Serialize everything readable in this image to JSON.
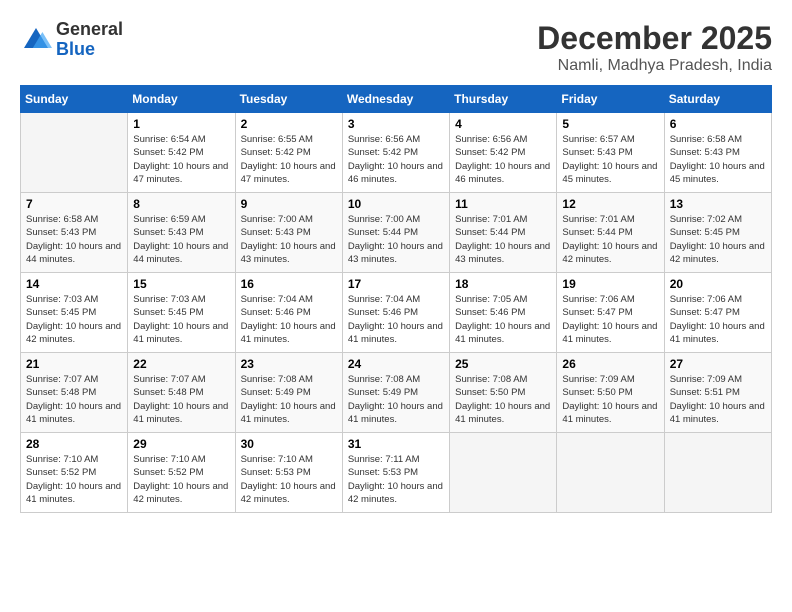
{
  "logo": {
    "general": "General",
    "blue": "Blue"
  },
  "title": "December 2025",
  "subtitle": "Namli, Madhya Pradesh, India",
  "headers": [
    "Sunday",
    "Monday",
    "Tuesday",
    "Wednesday",
    "Thursday",
    "Friday",
    "Saturday"
  ],
  "weeks": [
    [
      {
        "num": "",
        "sunrise": "",
        "sunset": "",
        "daylight": ""
      },
      {
        "num": "1",
        "sunrise": "Sunrise: 6:54 AM",
        "sunset": "Sunset: 5:42 PM",
        "daylight": "Daylight: 10 hours and 47 minutes."
      },
      {
        "num": "2",
        "sunrise": "Sunrise: 6:55 AM",
        "sunset": "Sunset: 5:42 PM",
        "daylight": "Daylight: 10 hours and 47 minutes."
      },
      {
        "num": "3",
        "sunrise": "Sunrise: 6:56 AM",
        "sunset": "Sunset: 5:42 PM",
        "daylight": "Daylight: 10 hours and 46 minutes."
      },
      {
        "num": "4",
        "sunrise": "Sunrise: 6:56 AM",
        "sunset": "Sunset: 5:42 PM",
        "daylight": "Daylight: 10 hours and 46 minutes."
      },
      {
        "num": "5",
        "sunrise": "Sunrise: 6:57 AM",
        "sunset": "Sunset: 5:43 PM",
        "daylight": "Daylight: 10 hours and 45 minutes."
      },
      {
        "num": "6",
        "sunrise": "Sunrise: 6:58 AM",
        "sunset": "Sunset: 5:43 PM",
        "daylight": "Daylight: 10 hours and 45 minutes."
      }
    ],
    [
      {
        "num": "7",
        "sunrise": "Sunrise: 6:58 AM",
        "sunset": "Sunset: 5:43 PM",
        "daylight": "Daylight: 10 hours and 44 minutes."
      },
      {
        "num": "8",
        "sunrise": "Sunrise: 6:59 AM",
        "sunset": "Sunset: 5:43 PM",
        "daylight": "Daylight: 10 hours and 44 minutes."
      },
      {
        "num": "9",
        "sunrise": "Sunrise: 7:00 AM",
        "sunset": "Sunset: 5:43 PM",
        "daylight": "Daylight: 10 hours and 43 minutes."
      },
      {
        "num": "10",
        "sunrise": "Sunrise: 7:00 AM",
        "sunset": "Sunset: 5:44 PM",
        "daylight": "Daylight: 10 hours and 43 minutes."
      },
      {
        "num": "11",
        "sunrise": "Sunrise: 7:01 AM",
        "sunset": "Sunset: 5:44 PM",
        "daylight": "Daylight: 10 hours and 43 minutes."
      },
      {
        "num": "12",
        "sunrise": "Sunrise: 7:01 AM",
        "sunset": "Sunset: 5:44 PM",
        "daylight": "Daylight: 10 hours and 42 minutes."
      },
      {
        "num": "13",
        "sunrise": "Sunrise: 7:02 AM",
        "sunset": "Sunset: 5:45 PM",
        "daylight": "Daylight: 10 hours and 42 minutes."
      }
    ],
    [
      {
        "num": "14",
        "sunrise": "Sunrise: 7:03 AM",
        "sunset": "Sunset: 5:45 PM",
        "daylight": "Daylight: 10 hours and 42 minutes."
      },
      {
        "num": "15",
        "sunrise": "Sunrise: 7:03 AM",
        "sunset": "Sunset: 5:45 PM",
        "daylight": "Daylight: 10 hours and 41 minutes."
      },
      {
        "num": "16",
        "sunrise": "Sunrise: 7:04 AM",
        "sunset": "Sunset: 5:46 PM",
        "daylight": "Daylight: 10 hours and 41 minutes."
      },
      {
        "num": "17",
        "sunrise": "Sunrise: 7:04 AM",
        "sunset": "Sunset: 5:46 PM",
        "daylight": "Daylight: 10 hours and 41 minutes."
      },
      {
        "num": "18",
        "sunrise": "Sunrise: 7:05 AM",
        "sunset": "Sunset: 5:46 PM",
        "daylight": "Daylight: 10 hours and 41 minutes."
      },
      {
        "num": "19",
        "sunrise": "Sunrise: 7:06 AM",
        "sunset": "Sunset: 5:47 PM",
        "daylight": "Daylight: 10 hours and 41 minutes."
      },
      {
        "num": "20",
        "sunrise": "Sunrise: 7:06 AM",
        "sunset": "Sunset: 5:47 PM",
        "daylight": "Daylight: 10 hours and 41 minutes."
      }
    ],
    [
      {
        "num": "21",
        "sunrise": "Sunrise: 7:07 AM",
        "sunset": "Sunset: 5:48 PM",
        "daylight": "Daylight: 10 hours and 41 minutes."
      },
      {
        "num": "22",
        "sunrise": "Sunrise: 7:07 AM",
        "sunset": "Sunset: 5:48 PM",
        "daylight": "Daylight: 10 hours and 41 minutes."
      },
      {
        "num": "23",
        "sunrise": "Sunrise: 7:08 AM",
        "sunset": "Sunset: 5:49 PM",
        "daylight": "Daylight: 10 hours and 41 minutes."
      },
      {
        "num": "24",
        "sunrise": "Sunrise: 7:08 AM",
        "sunset": "Sunset: 5:49 PM",
        "daylight": "Daylight: 10 hours and 41 minutes."
      },
      {
        "num": "25",
        "sunrise": "Sunrise: 7:08 AM",
        "sunset": "Sunset: 5:50 PM",
        "daylight": "Daylight: 10 hours and 41 minutes."
      },
      {
        "num": "26",
        "sunrise": "Sunrise: 7:09 AM",
        "sunset": "Sunset: 5:50 PM",
        "daylight": "Daylight: 10 hours and 41 minutes."
      },
      {
        "num": "27",
        "sunrise": "Sunrise: 7:09 AM",
        "sunset": "Sunset: 5:51 PM",
        "daylight": "Daylight: 10 hours and 41 minutes."
      }
    ],
    [
      {
        "num": "28",
        "sunrise": "Sunrise: 7:10 AM",
        "sunset": "Sunset: 5:52 PM",
        "daylight": "Daylight: 10 hours and 41 minutes."
      },
      {
        "num": "29",
        "sunrise": "Sunrise: 7:10 AM",
        "sunset": "Sunset: 5:52 PM",
        "daylight": "Daylight: 10 hours and 42 minutes."
      },
      {
        "num": "30",
        "sunrise": "Sunrise: 7:10 AM",
        "sunset": "Sunset: 5:53 PM",
        "daylight": "Daylight: 10 hours and 42 minutes."
      },
      {
        "num": "31",
        "sunrise": "Sunrise: 7:11 AM",
        "sunset": "Sunset: 5:53 PM",
        "daylight": "Daylight: 10 hours and 42 minutes."
      },
      {
        "num": "",
        "sunrise": "",
        "sunset": "",
        "daylight": ""
      },
      {
        "num": "",
        "sunrise": "",
        "sunset": "",
        "daylight": ""
      },
      {
        "num": "",
        "sunrise": "",
        "sunset": "",
        "daylight": ""
      }
    ]
  ]
}
